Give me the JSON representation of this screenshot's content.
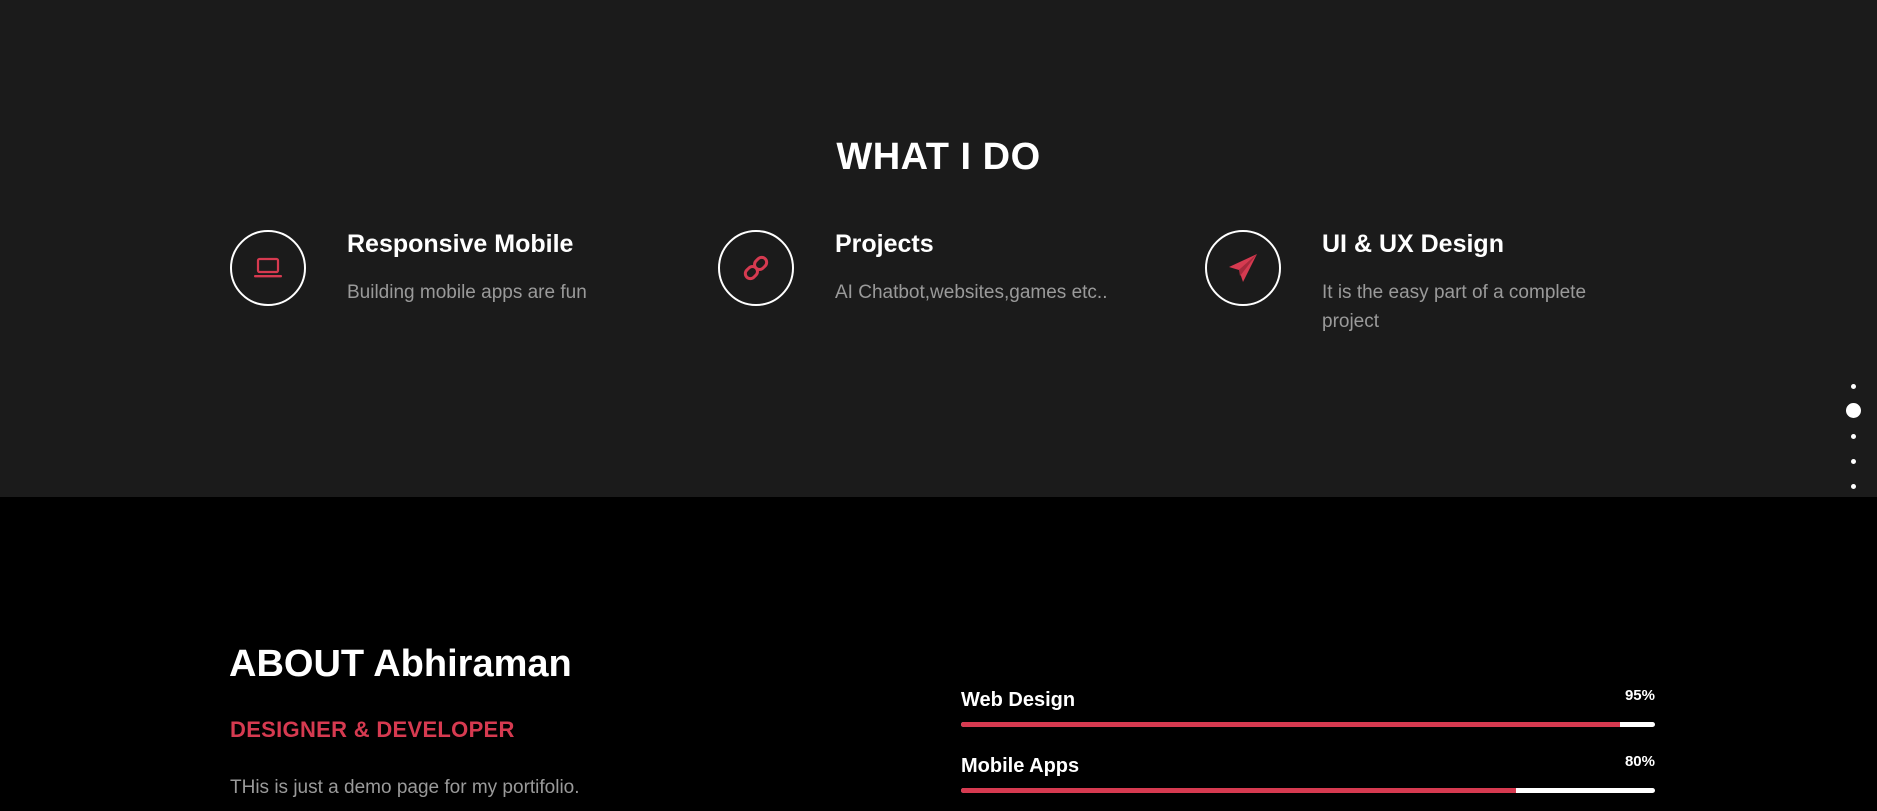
{
  "services": {
    "title": "WHAT I DO",
    "items": [
      {
        "name": "Responsive Mobile",
        "description": "Building mobile apps are fun",
        "icon": "laptop-icon"
      },
      {
        "name": "Projects",
        "description": "AI Chatbot,websites,games etc..",
        "icon": "link-icon"
      },
      {
        "name": "UI & UX Design",
        "description": "It is the easy part of a complete project",
        "icon": "paper-plane-icon"
      }
    ]
  },
  "nav_dots": {
    "count": 5,
    "active_index": 1
  },
  "about": {
    "title": "ABOUT Abhiraman",
    "subtitle": "DESIGNER & DEVELOPER",
    "text": "THis is just a demo page for my portifolio."
  },
  "skills": [
    {
      "name": "Web Design",
      "percent_label": "95%",
      "level": 0.95
    },
    {
      "name": "Mobile Apps",
      "percent_label": "80%",
      "level": 0.8
    }
  ],
  "colors": {
    "accent": "#d63a50",
    "services_bg": "#1b1b1b",
    "about_bg": "#000000",
    "muted_text": "#9a9a9a"
  }
}
